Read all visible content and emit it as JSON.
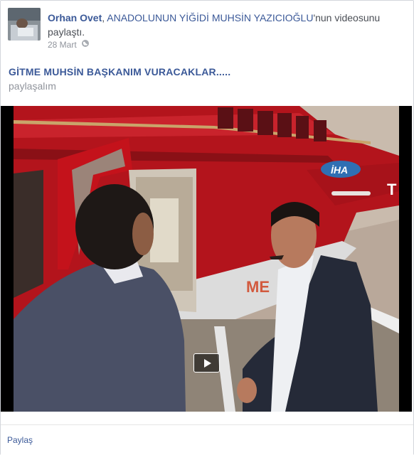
{
  "post": {
    "author": "Orhan Ovet",
    "comma": ", ",
    "page_name": "ANADOLUNUN YİĞİDİ MUHSİN YAZICIOĞLU",
    "action_suffix": "'nun videosunu paylaştı.",
    "date": "28 Mart",
    "privacy_icon": "globe-icon"
  },
  "link": {
    "title": "GİTME MUHSİN BAŞKANIM VURACAKLAR.....",
    "caption": "paylaşalım"
  },
  "video": {
    "logo_text": "İHA",
    "tail_letter": "T",
    "helicopter_text": "ME",
    "play_icon": "play-icon",
    "colors": {
      "helicopter": "#b3141c",
      "suit": "#3f4760",
      "sky": "#c4b4a4"
    }
  },
  "footer": {
    "share_label": "Paylaş"
  }
}
